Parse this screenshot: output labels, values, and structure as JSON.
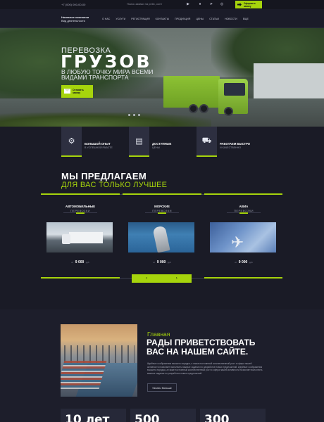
{
  "topbar": {
    "phone": "+7 (000) 000-00-00",
    "search_placeholder": "Поиск заявки на рейс, конт",
    "cta_line1": "Оформить",
    "cta_line2": "заявку"
  },
  "nav": {
    "brand_name": "Название компании",
    "brand_sub": "Вид деятельности",
    "menu": [
      "О нас",
      "Услуги",
      "Регистрация",
      "Контакты",
      "Продукция",
      "Цены",
      "Статьи",
      "Новости",
      "Еще"
    ]
  },
  "hero": {
    "line1": "ПЕРЕВОЗКА",
    "line2": "ГРУЗОВ",
    "line3": "В ЛЮБУЮ ТОЧКУ МИРА ВСЕМИ ВИДАМИ ТРАНСПОРТА",
    "button_line1": "Оставить",
    "button_line2": "заявку"
  },
  "features": [
    {
      "title": "Большой опыт",
      "subtitle": "в успешной работе",
      "icon": "gear-icon"
    },
    {
      "title": "Доступные",
      "subtitle": "цены",
      "icon": "boxes-icon"
    },
    {
      "title": "Работаем быстро",
      "subtitle": "и качественно",
      "icon": "truck-icon"
    }
  ],
  "offer": {
    "title": "МЫ ПРЕДЛАГАЕМ",
    "subtitle": "ДЛЯ ВАС ТОЛЬКО ЛУЧШЕЕ",
    "cards": [
      {
        "title": "Автомобильные",
        "subtitle": "перевозки",
        "price_prefix": "от",
        "price": "9 000",
        "price_unit": "руб"
      },
      {
        "title": "Морские",
        "subtitle": "перевозки",
        "price_prefix": "от",
        "price": "9 000",
        "price_unit": "руб"
      },
      {
        "title": "Авиа",
        "subtitle": "перевозки",
        "price_prefix": "от",
        "price": "9 000",
        "price_unit": "руб"
      }
    ],
    "slider_prev": "‹",
    "slider_next": "›"
  },
  "welcome": {
    "small": "Главная",
    "title": "РАДЫ ПРИВЕТСТВОВАТЬ ВАС НА НАШЕМ САЙТЕ.",
    "text": "Идейные соображения высшего порядка, а также постоянный количественный рост и сфера нашей активности позволяет выполнить важные задания по разработке новых предложений. Идейные соображения высшего порядка, а также постоянный количественный рост и сфера нашей активности позволяет выполнить важные задания по разработке новых предложений.",
    "button": "Узнать больше"
  },
  "stats": [
    "10 лет",
    "500",
    "300"
  ],
  "colors": {
    "accent": "#a6d40c",
    "background": "#1a1b26"
  }
}
